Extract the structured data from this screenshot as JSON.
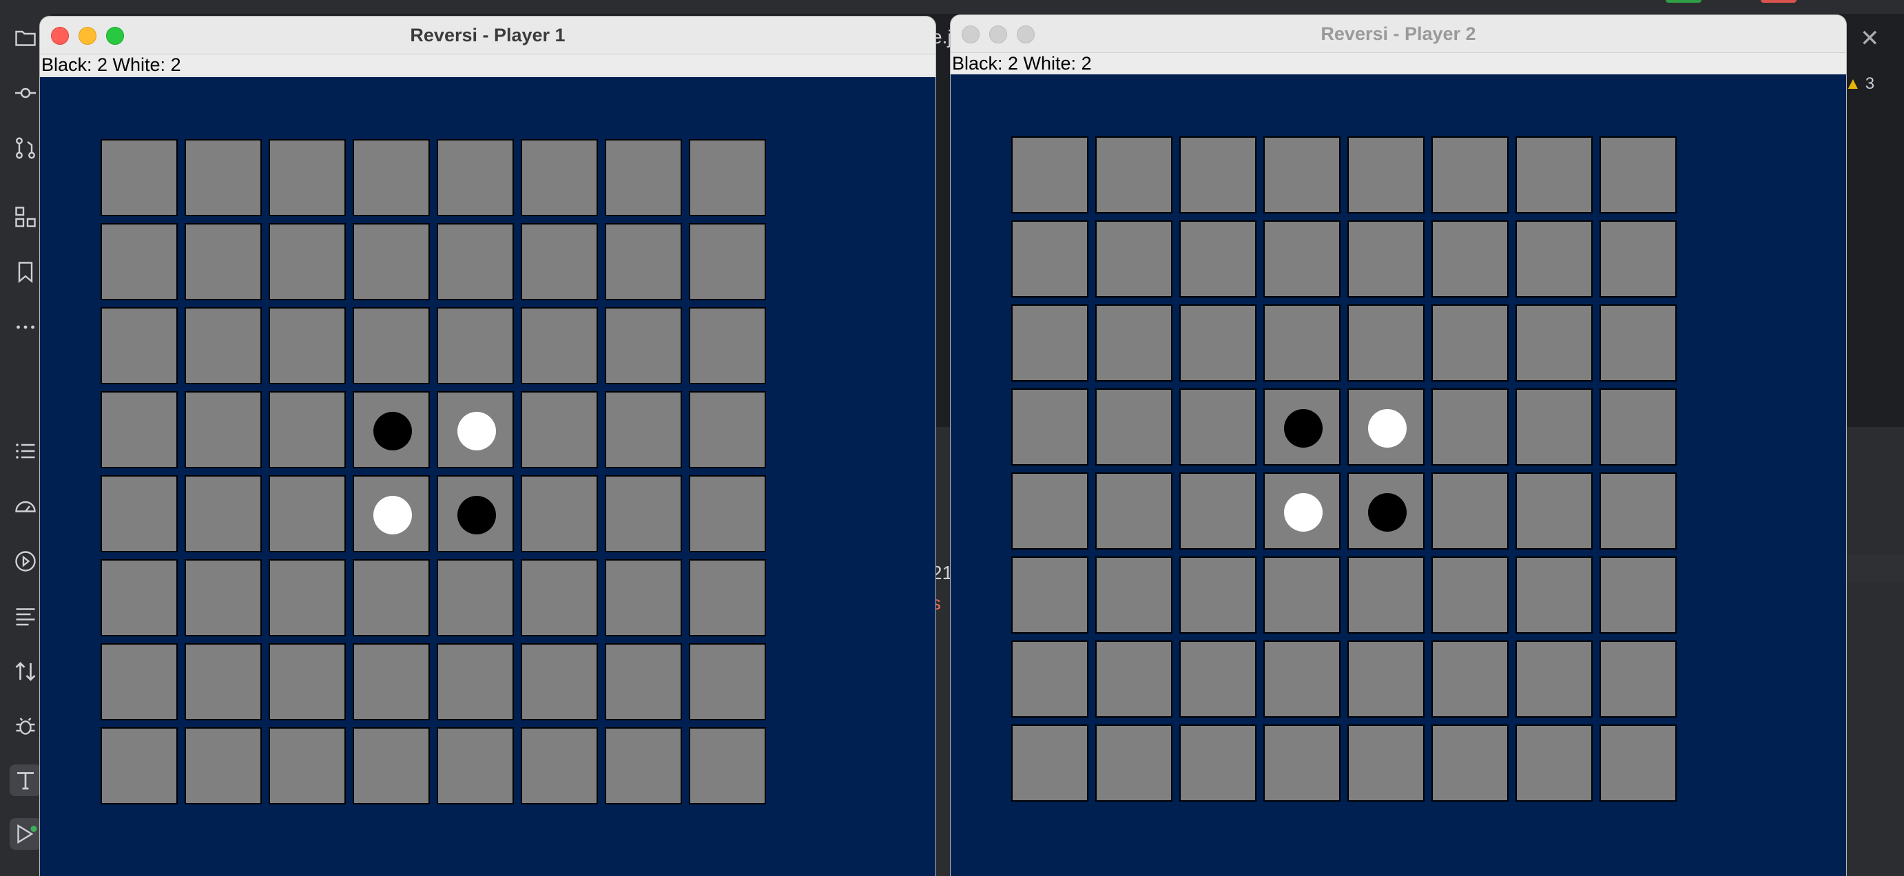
{
  "ide": {
    "fragments": {
      "tab_fragment": "e.j",
      "number_fragment": "21",
      "s_fragment": "s",
      "warning_count": "3"
    },
    "colors": {
      "badge_green": "#2f9e44",
      "badge_red": "#d9534f",
      "warning": "#e5b40a"
    }
  },
  "windows": [
    {
      "title": "Reversi - Player 1",
      "score": "Black: 2 White: 2",
      "focused": true,
      "pieces": [
        {
          "row": 3,
          "col": 3,
          "color": "black"
        },
        {
          "row": 3,
          "col": 4,
          "color": "white"
        },
        {
          "row": 4,
          "col": 3,
          "color": "white"
        },
        {
          "row": 4,
          "col": 4,
          "color": "black"
        }
      ]
    },
    {
      "title": "Reversi - Player 2",
      "score": "Black: 2 White: 2",
      "focused": false,
      "pieces": [
        {
          "row": 3,
          "col": 3,
          "color": "black"
        },
        {
          "row": 3,
          "col": 4,
          "color": "white"
        },
        {
          "row": 4,
          "col": 3,
          "color": "white"
        },
        {
          "row": 4,
          "col": 4,
          "color": "black"
        }
      ]
    }
  ],
  "board": {
    "size": 8,
    "background": "#002052",
    "cell_color": "#808080"
  }
}
